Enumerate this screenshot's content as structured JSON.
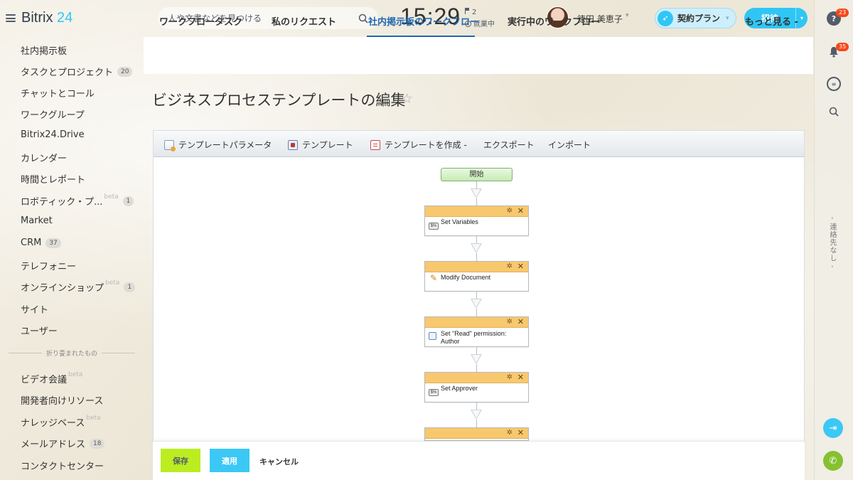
{
  "header": {
    "logo_main": "Bitrix",
    "logo_num": "24",
    "search_placeholder": "人や文書などを見つける",
    "time": "15:29",
    "flag_count": "2",
    "work_status": "就業中",
    "user_name": "徳田 美恵子",
    "plan_label": "契約プラン",
    "invite_label": "招待"
  },
  "sidebar": {
    "items": [
      {
        "label": "社内掲示板"
      },
      {
        "label": "タスクとプロジェクト",
        "badge": "20"
      },
      {
        "label": "チャットとコール"
      },
      {
        "label": "ワークグループ"
      },
      {
        "label": "Bitrix24.Drive"
      },
      {
        "label": "カレンダー"
      },
      {
        "label": "時間とレポート"
      },
      {
        "label": "ロボティック・プ...",
        "beta": "beta",
        "badge": "1"
      },
      {
        "label": "Market"
      },
      {
        "label": "CRM",
        "badge": "37"
      },
      {
        "label": "テレフォニー"
      },
      {
        "label": "オンラインショップ",
        "beta": "beta",
        "badge": "1"
      },
      {
        "label": "サイト"
      },
      {
        "label": "ユーザー"
      }
    ],
    "collapsed_label": "折り畳まれたもの",
    "collapsed_items": [
      {
        "label": "ビデオ会議",
        "beta": "beta"
      },
      {
        "label": "開発者向けリソース"
      },
      {
        "label": "ナレッジベース",
        "beta": "beta"
      },
      {
        "label": "メールアドレス",
        "badge": "18"
      },
      {
        "label": "コンタクトセンター"
      }
    ]
  },
  "tabs": [
    {
      "label": "ワークフロータスク"
    },
    {
      "label": "私のリクエスト"
    },
    {
      "label": "社内掲示板のワークフロー"
    },
    {
      "label": "実行中のワークフロー"
    },
    {
      "label": "もっと見る -"
    }
  ],
  "page_title": "ビジネスプロセステンプレートの編集",
  "toolbar": {
    "params": "テンプレートパラメータ",
    "template": "テンプレート",
    "create": "テンプレートを作成 -",
    "export": "エクスポート",
    "import": "インポート"
  },
  "workflow": {
    "start": "開始",
    "activities": [
      {
        "label": "Set Variables",
        "icon": "variables-icon"
      },
      {
        "label": "Modify Document",
        "icon": "pencil-icon"
      },
      {
        "label": "Set \"Read\" permission: Author",
        "icon": "permission-icon"
      },
      {
        "label": "Set Approver",
        "icon": "variables-icon"
      },
      {
        "label": ""
      }
    ]
  },
  "rightbar": {
    "help_badge": "23",
    "notify_badge": "35",
    "contacts_label": "- 連絡先なし -"
  },
  "footer": {
    "save": "保存",
    "apply": "適用",
    "cancel": "キャンセル"
  },
  "colors": {
    "accent": "#2fc6f6",
    "active_tab": "#2067b0",
    "save_btn": "#bbed21",
    "activity_header": "#f8c86e",
    "badge_red": "#f54819"
  }
}
